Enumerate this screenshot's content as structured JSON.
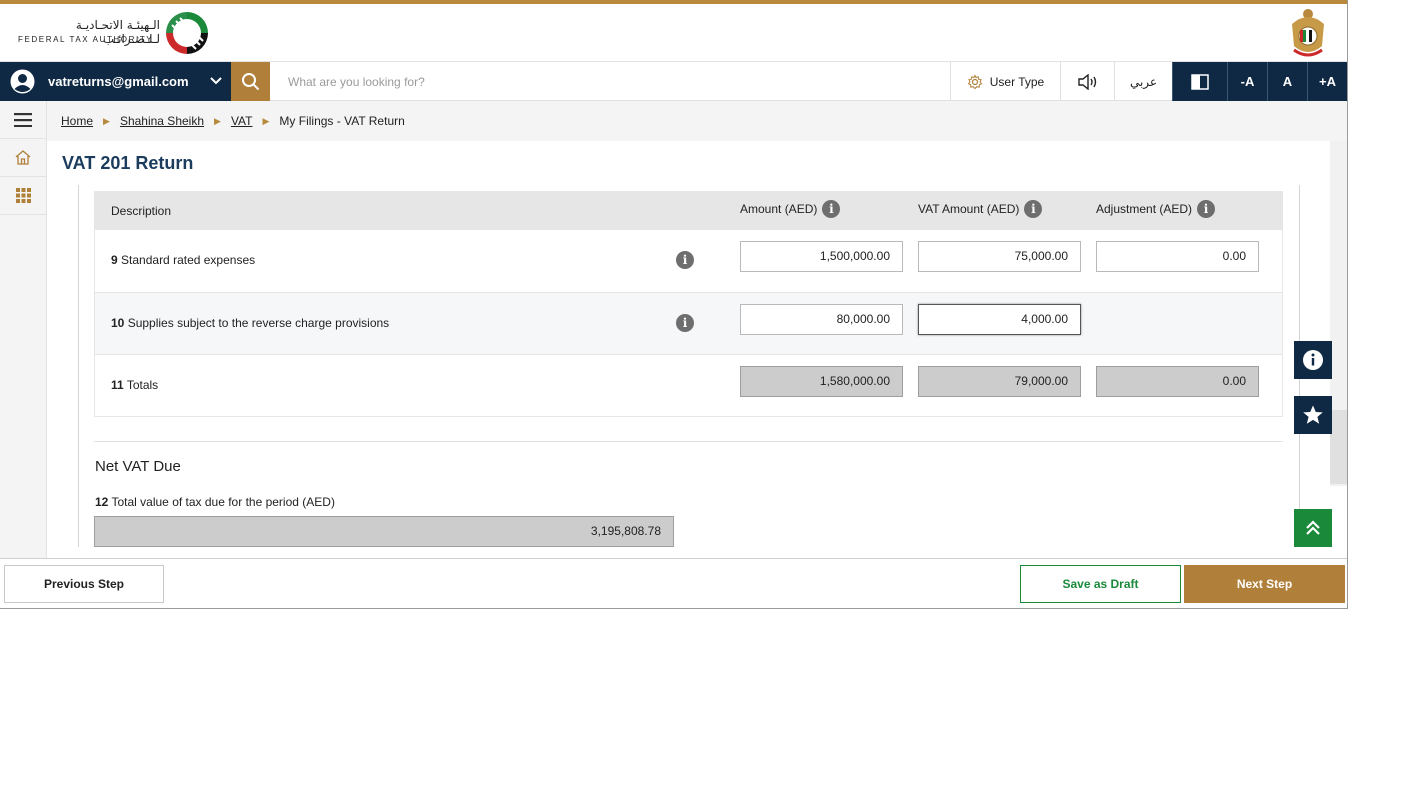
{
  "header": {
    "logo_arabic": "الـهيئـة الاتحـاديـة لـلـضـرائـب",
    "logo_english": "FEDERAL TAX AUTHORITY"
  },
  "toolbar": {
    "user_email": "vatreturns@gmail.com",
    "search_placeholder": "What are you looking for?",
    "user_type_label": "User Type",
    "language_label": "عربي",
    "font_decrease": "-A",
    "font_normal": "A",
    "font_increase": "+A"
  },
  "breadcrumb": {
    "items": [
      "Home",
      "Shahina Sheikh",
      "VAT"
    ],
    "current": "My Filings - VAT Return"
  },
  "page": {
    "title": "VAT 201 Return"
  },
  "table": {
    "headers": {
      "description": "Description",
      "amount": "Amount (AED)",
      "vat_amount": "VAT Amount (AED)",
      "adjustment": "Adjustment (AED)"
    },
    "rows": [
      {
        "num": "9",
        "label": "Standard rated expenses",
        "amount": "1,500,000.00",
        "vat": "75,000.00",
        "adjustment": "0.00"
      },
      {
        "num": "10",
        "label": "Supplies subject to the reverse charge provisions",
        "amount": "80,000.00",
        "vat": "4,000.00",
        "adjustment": ""
      },
      {
        "num": "11",
        "label": "Totals",
        "amount": "1,580,000.00",
        "vat": "79,000.00",
        "adjustment": "0.00"
      }
    ],
    "info_glyph": "i"
  },
  "net_vat": {
    "title": "Net VAT Due",
    "num": "12",
    "label": "Total value of tax due for the period (AED)",
    "value": "3,195,808.78"
  },
  "footer": {
    "previous": "Previous Step",
    "save_draft": "Save as Draft",
    "next": "Next Step"
  },
  "colors": {
    "navy": "#0f2944",
    "gold": "#b0803a",
    "green": "#1a8a3a",
    "title_blue": "#1c3c5e"
  },
  "icons": [
    "user-avatar-icon",
    "chevron-down-icon",
    "search-icon",
    "gear-icon",
    "speaker-icon",
    "contrast-icon",
    "menu-icon",
    "home-icon",
    "grid-icon",
    "info-icon",
    "star-icon",
    "double-chevron-up-icon"
  ]
}
